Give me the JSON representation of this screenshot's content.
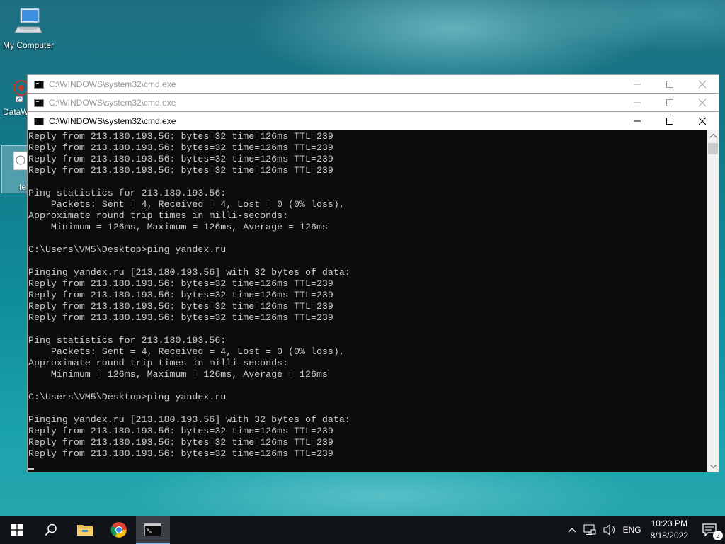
{
  "desktop": {
    "icons": [
      {
        "label": "My Computer"
      },
      {
        "label": "DataW"
      },
      {
        "label": "te"
      }
    ]
  },
  "windows": [
    {
      "title": "C:\\WINDOWS\\system32\\cmd.exe"
    },
    {
      "title": "C:\\WINDOWS\\system32\\cmd.exe"
    },
    {
      "title": "C:\\WINDOWS\\system32\\cmd.exe"
    }
  ],
  "console": {
    "text": "Reply from 213.180.193.56: bytes=32 time=126ms TTL=239\nReply from 213.180.193.56: bytes=32 time=126ms TTL=239\nReply from 213.180.193.56: bytes=32 time=126ms TTL=239\nReply from 213.180.193.56: bytes=32 time=126ms TTL=239\n\nPing statistics for 213.180.193.56:\n    Packets: Sent = 4, Received = 4, Lost = 0 (0% loss),\nApproximate round trip times in milli-seconds:\n    Minimum = 126ms, Maximum = 126ms, Average = 126ms\n\nC:\\Users\\VM5\\Desktop>ping yandex.ru\n\nPinging yandex.ru [213.180.193.56] with 32 bytes of data:\nReply from 213.180.193.56: bytes=32 time=126ms TTL=239\nReply from 213.180.193.56: bytes=32 time=126ms TTL=239\nReply from 213.180.193.56: bytes=32 time=126ms TTL=239\nReply from 213.180.193.56: bytes=32 time=126ms TTL=239\n\nPing statistics for 213.180.193.56:\n    Packets: Sent = 4, Received = 4, Lost = 0 (0% loss),\nApproximate round trip times in milli-seconds:\n    Minimum = 126ms, Maximum = 126ms, Average = 126ms\n\nC:\\Users\\VM5\\Desktop>ping yandex.ru\n\nPinging yandex.ru [213.180.193.56] with 32 bytes of data:\nReply from 213.180.193.56: bytes=32 time=126ms TTL=239\nReply from 213.180.193.56: bytes=32 time=126ms TTL=239\nReply from 213.180.193.56: bytes=32 time=126ms TTL=239",
    "colors": {
      "background": "#0c0c0c",
      "foreground": "#cccccc"
    }
  },
  "taskbar": {
    "pinned": [
      {
        "icon": "start-icon"
      },
      {
        "icon": "search-icon"
      },
      {
        "icon": "file-explorer-icon"
      },
      {
        "icon": "chrome-icon"
      },
      {
        "icon": "cmd-icon",
        "active": true
      }
    ],
    "tray": {
      "language": "ENG",
      "time": "10:23 PM",
      "date": "8/18/2022",
      "notification_count": "2"
    }
  }
}
